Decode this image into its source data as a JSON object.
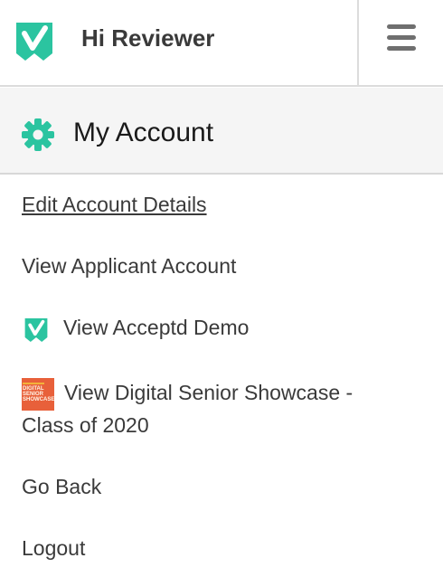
{
  "header": {
    "greeting": "Hi Reviewer",
    "logo_icon": "acceptd-check-logo-icon",
    "menu_icon": "hamburger-menu-icon"
  },
  "account_bar": {
    "title": "My Account",
    "icon": "gear-icon",
    "accent_color": "#2bc4a0"
  },
  "menu": {
    "items": [
      {
        "label": "Edit Account Details"
      },
      {
        "label": "View Applicant Account"
      },
      {
        "label": "View Acceptd Demo",
        "icon": "acceptd-check-logo-icon"
      },
      {
        "label_line1": "View Digital Senior Showcase -",
        "label_line2": "Class of 2020",
        "icon": "digital-senior-showcase-thumbnail",
        "thumbnail_text": "DIGITAL SENIOR SHOWCASE"
      },
      {
        "label": "Go Back"
      },
      {
        "label": "Logout"
      }
    ]
  }
}
